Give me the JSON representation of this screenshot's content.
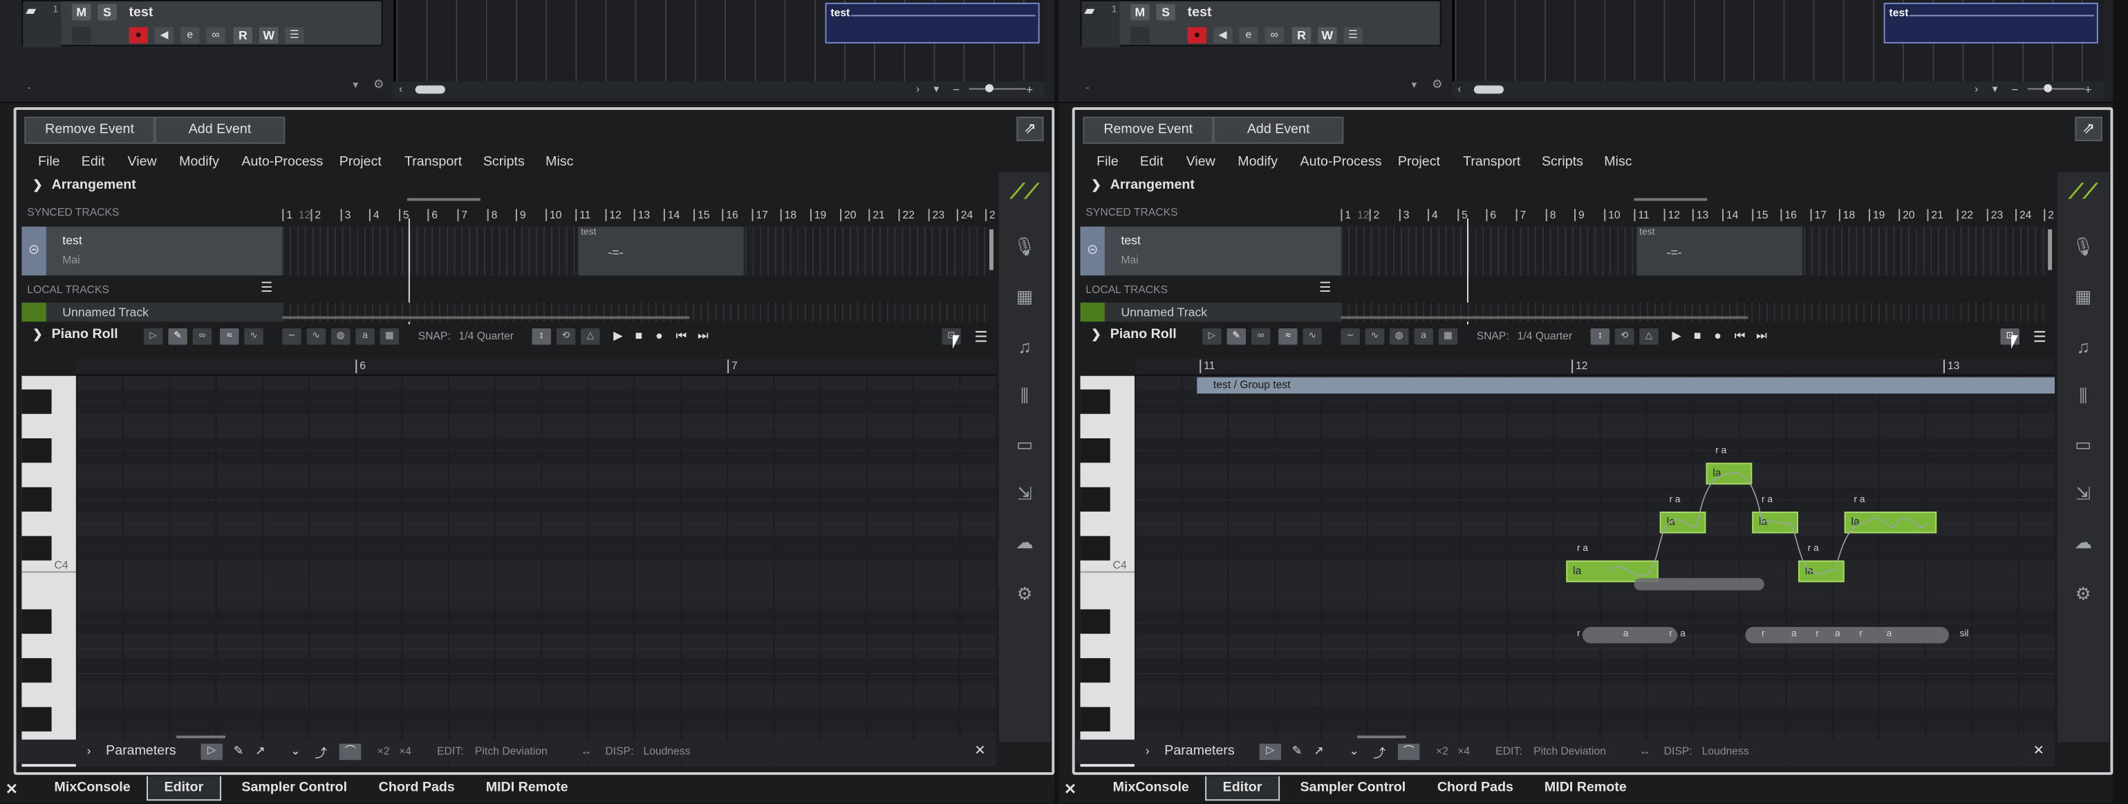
{
  "top": {
    "track_number": "1",
    "track_name": "test",
    "mute": "M",
    "solo": "S",
    "read": "R",
    "write": "W",
    "event_name": "test",
    "lower_label": "-"
  },
  "toolbar": {
    "remove_event": "Remove Event",
    "add_event": "Add Event"
  },
  "menus": [
    "File",
    "Edit",
    "View",
    "Modify",
    "Auto-Process",
    "Project",
    "Transport",
    "Scripts",
    "Misc"
  ],
  "arrangement": {
    "title": "Arrangement",
    "synced_tracks": "SYNCED TRACKS",
    "local_tracks": "LOCAL TRACKS",
    "sync_track_name": "test",
    "sync_track_singer": "Mai",
    "local_track_name": "Unnamed Track",
    "sync_event": "test",
    "ruler": [
      "1",
      "12",
      "2",
      "3",
      "4",
      "5",
      "6",
      "7",
      "8",
      "9",
      "10",
      "11",
      "12",
      "13",
      "14",
      "15",
      "16",
      "17",
      "18",
      "19",
      "20",
      "21",
      "22",
      "23",
      "24",
      "2"
    ]
  },
  "pianoroll": {
    "title": "Piano Roll",
    "snap_label": "SNAP:",
    "snap_value": "1/4 Quarter",
    "left_ruler": [
      "6",
      "7"
    ],
    "right_ruler": [
      "11",
      "12",
      "13"
    ],
    "c4": "C4",
    "group": "test / Group test"
  },
  "notes": [
    {
      "lyric": "la",
      "phoneme": "r a"
    },
    {
      "lyric": "la",
      "phoneme": "r a"
    },
    {
      "lyric": "la",
      "phoneme": "r a"
    },
    {
      "lyric": "la",
      "phoneme": "r a"
    },
    {
      "lyric": "la",
      "phoneme": "r a"
    },
    {
      "lyric": "la",
      "phoneme": "r a"
    }
  ],
  "phonemes_bottom": [
    "r",
    "a",
    "r",
    "a",
    "r",
    "a",
    "r",
    "a",
    "r",
    "a",
    "sil"
  ],
  "parameters": {
    "title": "Parameters",
    "x2": "×2",
    "x4": "×4",
    "edit": "EDIT:",
    "edit_value": "Pitch Deviation",
    "disp": "DISP:",
    "disp_value": "Loudness"
  },
  "tabs": [
    "MixConsole",
    "Editor",
    "Sampler Control",
    "Chord Pads",
    "MIDI Remote"
  ]
}
